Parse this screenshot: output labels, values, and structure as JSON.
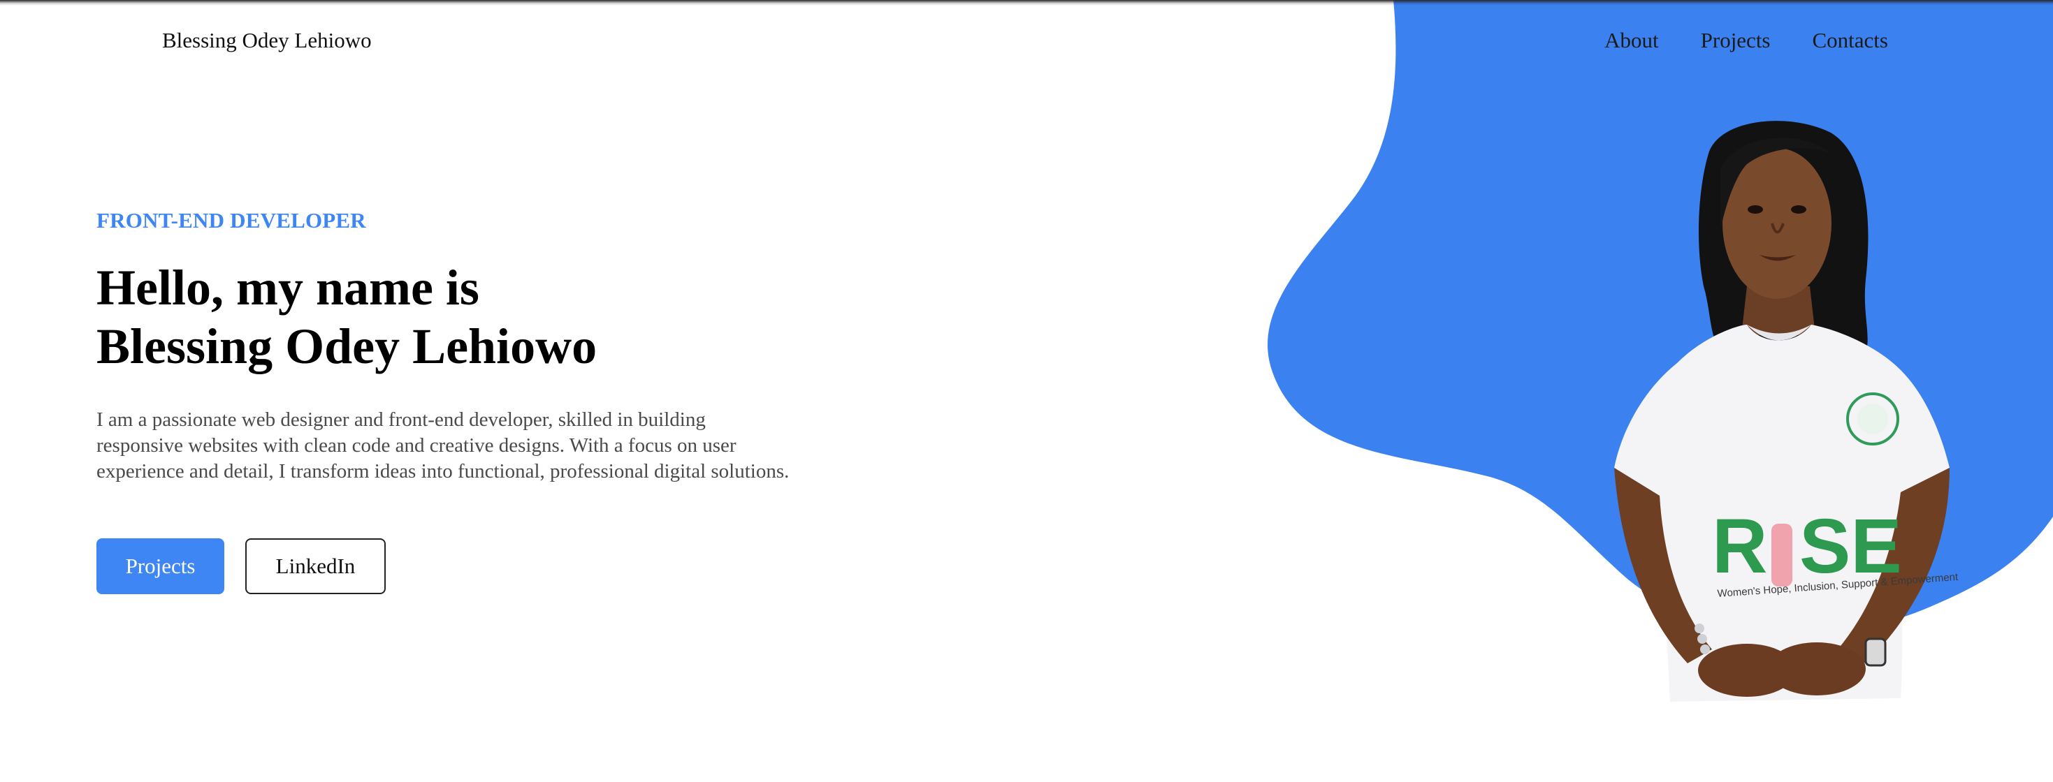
{
  "header": {
    "brand": "Blessing Odey Lehiowo",
    "nav": [
      {
        "label": "About"
      },
      {
        "label": "Projects"
      },
      {
        "label": "Contacts"
      }
    ]
  },
  "hero": {
    "role": "FRONT-END DEVELOPER",
    "headline_line1": "Hello, my name is",
    "headline_line2": "Blessing Odey Lehiowo",
    "bio": "I am a passionate web designer and front-end developer, skilled in building responsive websites with clean code and creative designs. With a focus on user experience and detail, I transform ideas into functional, professional digital solutions.",
    "buttons": {
      "primary": "Projects",
      "secondary": "LinkedIn"
    },
    "portrait": {
      "shirt_text": "RISE",
      "shirt_subtext": "Women's Hope, Inclusion, Support & Empowerment"
    }
  },
  "colors": {
    "accent": "#3d86f3",
    "blob": "#3b82f0",
    "text_dark": "#000000",
    "text_body": "#4a4a4a"
  }
}
